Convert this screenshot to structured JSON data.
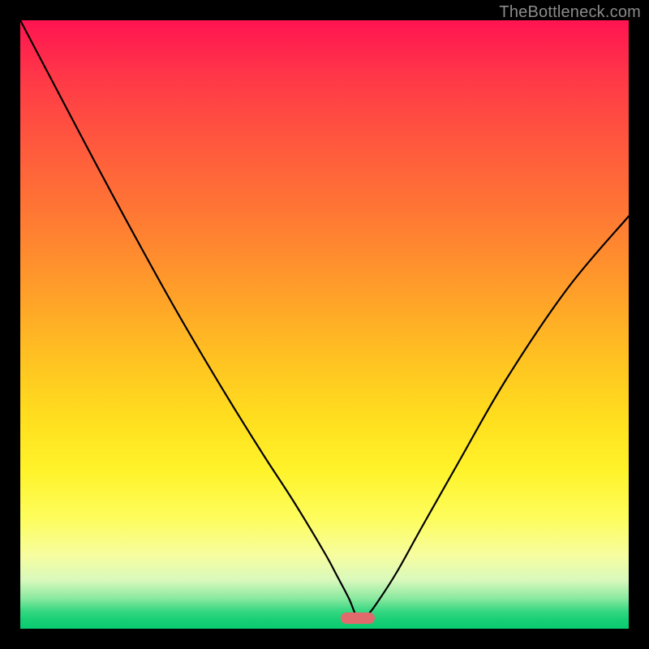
{
  "watermark": "TheBottleneck.com",
  "marker": {
    "x_frac": 0.555,
    "y_frac": 0.983,
    "color": "#e16a6d"
  },
  "chart_data": {
    "type": "line",
    "title": "",
    "xlabel": "",
    "ylabel": "",
    "xlim": [
      0,
      100
    ],
    "ylim": [
      0,
      100
    ],
    "grid": false,
    "legend": false,
    "series": [
      {
        "name": "bottleneck-curve",
        "x": [
          0,
          5,
          10,
          15,
          20,
          25,
          30,
          35,
          40,
          45,
          50,
          52,
          54,
          55.5,
          57,
          59,
          62,
          66,
          72,
          80,
          90,
          100
        ],
        "y": [
          100,
          90.5,
          81,
          71.6,
          62.4,
          53.4,
          44.8,
          36.5,
          28.5,
          20.8,
          12.5,
          8.8,
          5.0,
          1.7,
          2.2,
          4.8,
          9.5,
          16.7,
          27.3,
          41.2,
          56.0,
          67.8
        ]
      }
    ],
    "annotations": [
      {
        "type": "pill-marker",
        "x": 55.5,
        "y": 1.7,
        "color": "#e16a6d"
      }
    ]
  }
}
